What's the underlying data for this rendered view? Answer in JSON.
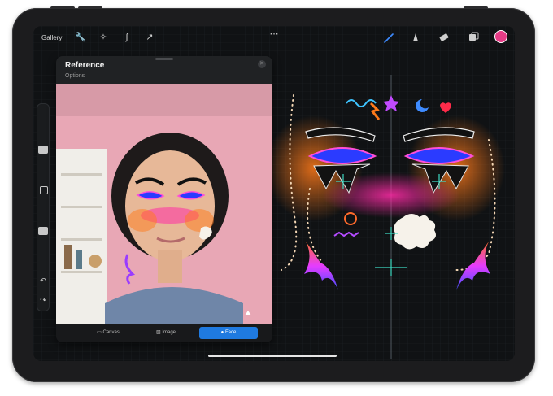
{
  "toolbar": {
    "gallery_label": "Gallery",
    "more_icon": "ellipsis-icon",
    "left_tools": [
      "wrench-icon",
      "magic-wand-icon",
      "selection-icon",
      "transform-arrow-icon"
    ],
    "right_tools": [
      "brush-icon",
      "smudge-icon",
      "eraser-icon",
      "layers-icon"
    ],
    "active_color": "#e63c86"
  },
  "reference_panel": {
    "title": "Reference",
    "subtitle": "Options",
    "close_icon": "close-icon",
    "tabs": [
      {
        "label": "Canvas",
        "icon": "canvas-icon",
        "active": false
      },
      {
        "label": "Image",
        "icon": "image-icon",
        "active": false
      },
      {
        "label": "Face",
        "icon": "face-icon",
        "active": true
      }
    ],
    "active_tab_color": "#1f7ae0"
  },
  "sidebar": {
    "icons": [
      "modify-square-icon",
      "undo-icon",
      "redo-icon"
    ]
  },
  "colors": {
    "canvas_bg": "#101214",
    "accent_pink": "#e63c86",
    "accent_blue": "#1f7ae0"
  }
}
